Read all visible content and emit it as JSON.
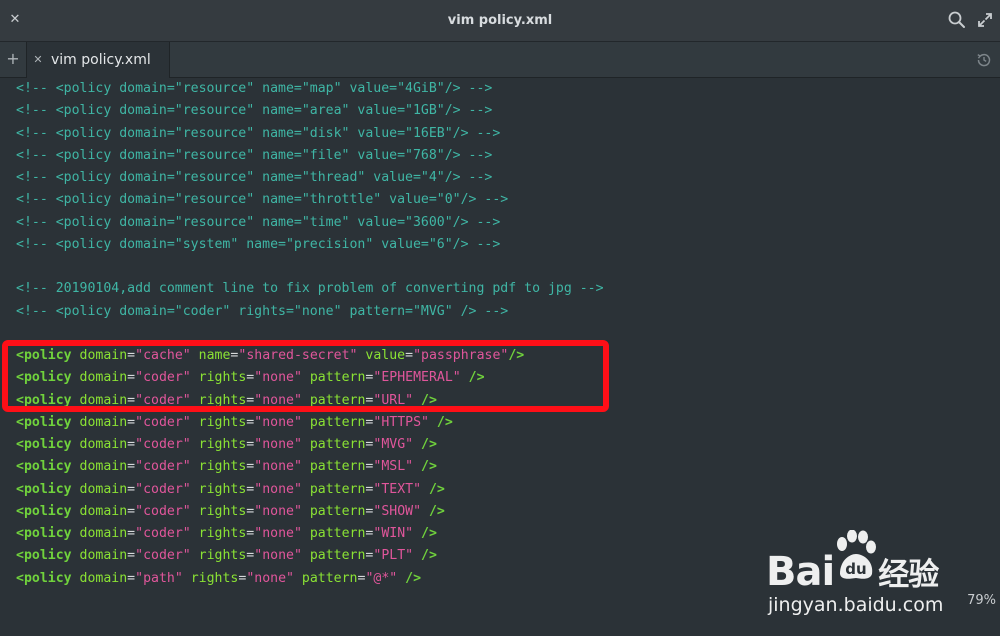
{
  "window": {
    "title": "vim policy.xml",
    "close_icon": "close-icon",
    "search_icon": "search-icon",
    "expand_icon": "expand-icon"
  },
  "tabs": {
    "new_tab_icon": "plus-icon",
    "active_tab": {
      "label": "vim policy.xml",
      "close_icon": "close-icon"
    },
    "history_icon": "history-icon"
  },
  "colors": {
    "background": "#2b3237",
    "comment": "#3fb6a5",
    "tag": "#70d23c",
    "attribute": "#8ae234",
    "value": "#e0569b",
    "highlight_box": "#ff0f17"
  },
  "editor": {
    "lines": [
      "<!-- <policy domain=\"resource\" name=\"map\" value=\"4GiB\"/> -->",
      "<!-- <policy domain=\"resource\" name=\"area\" value=\"1GB\"/> -->",
      "<!-- <policy domain=\"resource\" name=\"disk\" value=\"16EB\"/> -->",
      "<!-- <policy domain=\"resource\" name=\"file\" value=\"768\"/> -->",
      "<!-- <policy domain=\"resource\" name=\"thread\" value=\"4\"/> -->",
      "<!-- <policy domain=\"resource\" name=\"throttle\" value=\"0\"/> -->",
      "<!-- <policy domain=\"resource\" name=\"time\" value=\"3600\"/> -->",
      "<!-- <policy domain=\"system\" name=\"precision\" value=\"6\"/> -->",
      "",
      "<!-- 20190104,add comment line to fix problem of converting pdf to jpg -->",
      "<!-- <policy domain=\"coder\" rights=\"none\" pattern=\"MVG\" /> -->",
      "",
      "<policy domain=\"cache\" name=\"shared-secret\" value=\"passphrase\"/>",
      "<policy domain=\"coder\" rights=\"none\" pattern=\"EPHEMERAL\" />",
      "<policy domain=\"coder\" rights=\"none\" pattern=\"URL\" />",
      "<policy domain=\"coder\" rights=\"none\" pattern=\"HTTPS\" />",
      "<policy domain=\"coder\" rights=\"none\" pattern=\"MVG\" />",
      "<policy domain=\"coder\" rights=\"none\" pattern=\"MSL\" />",
      "<policy domain=\"coder\" rights=\"none\" pattern=\"TEXT\" />",
      "<policy domain=\"coder\" rights=\"none\" pattern=\"SHOW\" />",
      "<policy domain=\"coder\" rights=\"none\" pattern=\"WIN\" />",
      "<policy domain=\"coder\" rights=\"none\" pattern=\"PLT\" />",
      "<policy domain=\"path\" rights=\"none\" pattern=\"@*\" />"
    ]
  },
  "status": {
    "zoom": "79%"
  },
  "watermark": {
    "logo_text": "Bai",
    "logo_suffix": "经验",
    "url": "jingyan.baidu.com"
  }
}
